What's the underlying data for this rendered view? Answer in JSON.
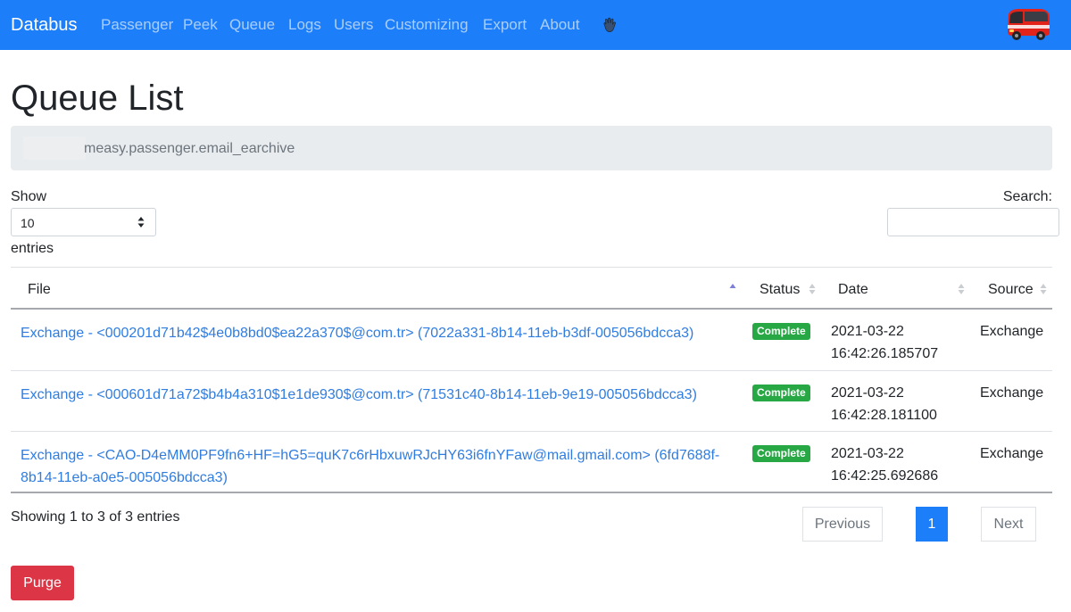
{
  "navbar": {
    "brand": "Databus",
    "items": [
      "Passenger",
      "Peek",
      "Queue",
      "Logs",
      "Users",
      "Customizing",
      "Export",
      "About"
    ],
    "wave_icon": "waving-hand-icon",
    "logo": "bus-logo"
  },
  "page": {
    "title": "Queue List",
    "breadcrumb": "measy.passenger.email_earchive"
  },
  "controls": {
    "show_label": "Show",
    "entries_value": "10",
    "entries_label": "entries",
    "search_label": "Search:",
    "search_value": ""
  },
  "table": {
    "headers": [
      "File",
      "Status",
      "Date",
      "Source"
    ],
    "rows": [
      {
        "file": "Exchange - <000201d71b42$4e0b8bd0$ea22a370$@com.tr> (7022a331-8b14-11eb-b3df-005056bdcca3)",
        "status": "Complete",
        "date_day": "2021-03-22",
        "date_time": "16:42:26.185707",
        "source": "Exchange"
      },
      {
        "file": "Exchange - <000601d71a72$b4b4a310$1e1de930$@com.tr> (71531c40-8b14-11eb-9e19-005056bdcca3)",
        "status": "Complete",
        "date_day": "2021-03-22",
        "date_time": "16:42:28.181100",
        "source": "Exchange"
      },
      {
        "file": "Exchange - <CAO-D4eMM0PF9fn6+HF=hG5=quK7c6rHbxuwRJcHY63i6fnYFaw@mail.gmail.com> (6fd7688f-8b14-11eb-a0e5-005056bdcca3)",
        "status": "Complete",
        "date_day": "2021-03-22",
        "date_time": "16:42:25.692686",
        "source": "Exchange"
      }
    ]
  },
  "footer": {
    "info": "Showing 1 to 3 of 3 entries",
    "previous": "Previous",
    "current_page": "1",
    "next": "Next",
    "purge": "Purge"
  },
  "colors": {
    "primary": "#1d7ef9",
    "success": "#28a745",
    "danger": "#dc3545",
    "link": "#2f7de1"
  }
}
